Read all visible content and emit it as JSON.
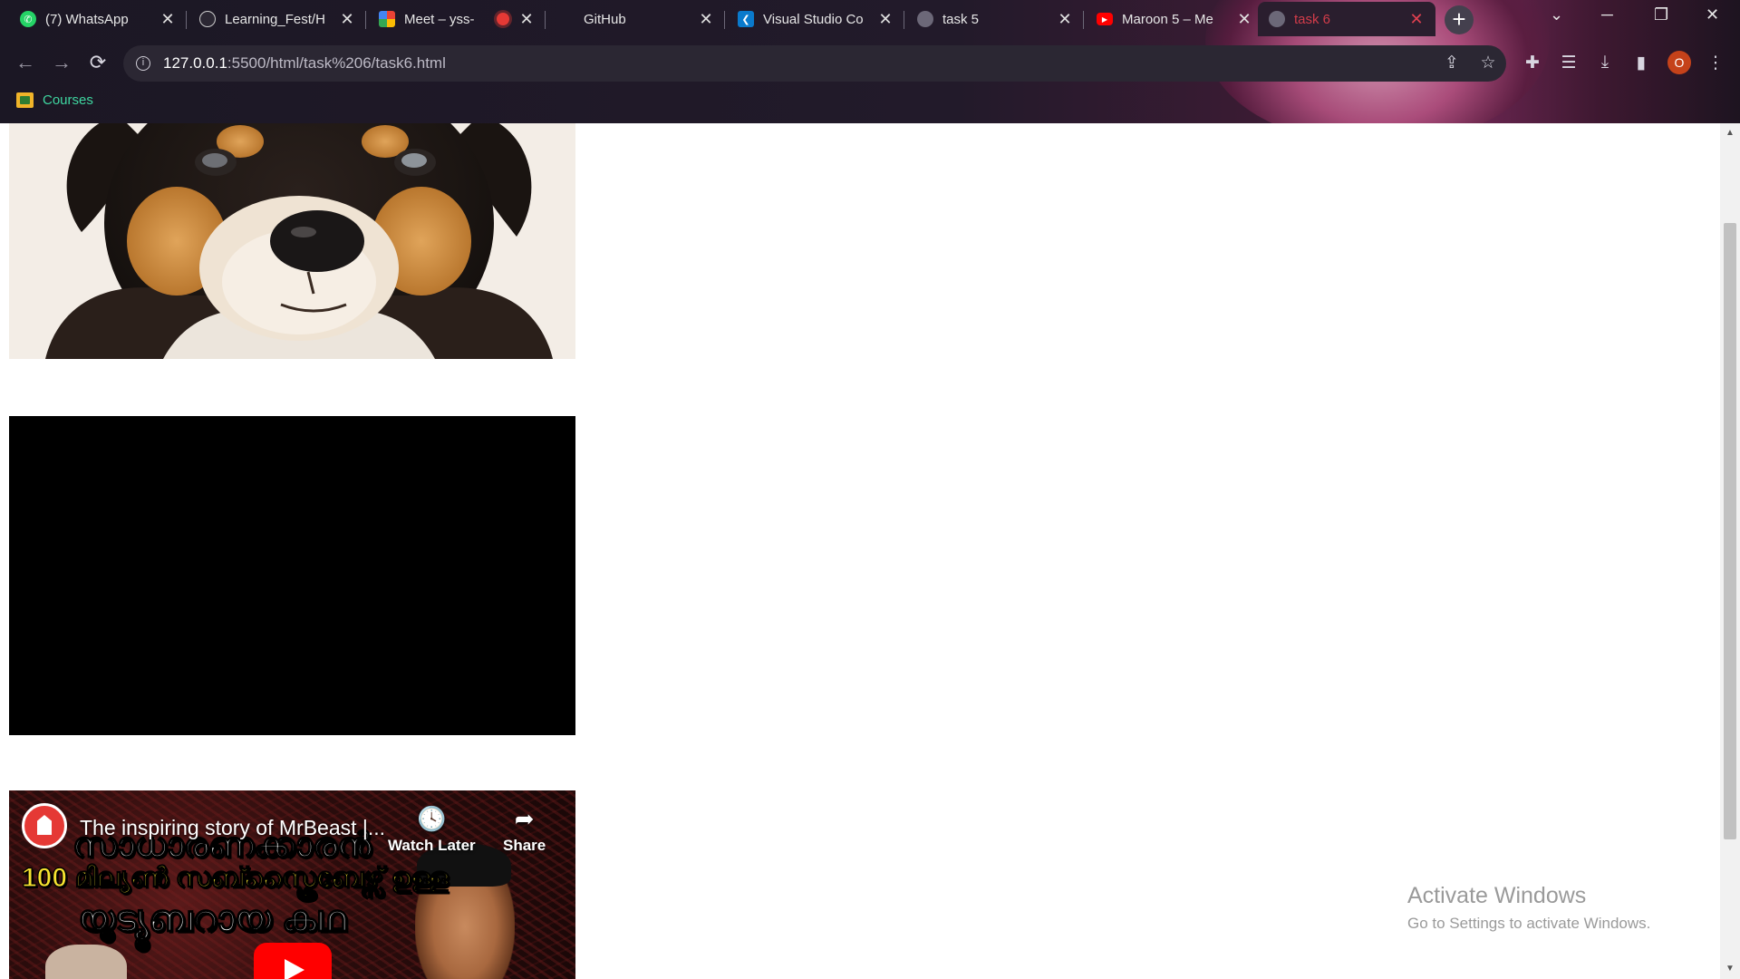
{
  "tabs": [
    {
      "title": "(7) WhatsApp",
      "icon": "whatsapp-icon",
      "color": "#25d366",
      "active": false
    },
    {
      "title": "Learning_Fest/H",
      "icon": "github-icon",
      "color": "#2b2733",
      "active": false
    },
    {
      "title": "Meet – yss-",
      "icon": "google-meet-icon",
      "color": "#00897b",
      "active": false
    },
    {
      "title": "GitHub",
      "icon": "github-icon",
      "color": "#2b2733",
      "active": false
    },
    {
      "title": "Visual Studio Co",
      "icon": "vscode-icon",
      "color": "#0a7acc",
      "active": false
    },
    {
      "title": "task 5",
      "icon": "globe-icon",
      "color": "#6c6878",
      "active": false
    },
    {
      "title": "Maroon 5 – Me",
      "icon": "youtube-icon",
      "color": "#ff0000",
      "active": false
    },
    {
      "title": "task 6",
      "icon": "globe-icon",
      "color": "#6c6878",
      "active": true
    }
  ],
  "tab_close_glyph": "✕",
  "new_tab_glyph": "+",
  "window_controls": {
    "dropdown": "⌄",
    "minimize": "─",
    "restore": "❐",
    "close": "✕"
  },
  "toolbar": {
    "back": "←",
    "forward": "→",
    "reload": "⟳",
    "url_host": "127.0.0.1",
    "url_path": ":5500/html/task%206/task6.html",
    "share": "⇪",
    "bookmark_star": "☆",
    "extensions": "✚",
    "reading_list": "☰",
    "download": "⤓",
    "side_panel": "▮",
    "profile_initial": "O",
    "menu": "⋮"
  },
  "bookmarks": [
    {
      "label": "Courses",
      "icon": "google-classroom-icon"
    }
  ],
  "youtube_embed": {
    "title": "The inspiring story of MrBeast |...",
    "watch_later": "Watch Later",
    "share": "Share",
    "line1": "സാധാരണക്കാരൻ",
    "line2": "100 മില്യൺ സബ്സ്ക്രൈബേഴ്സ് ഉള്ള",
    "line3": "യൂട്യൂബറായ കഥ",
    "colors": {
      "play": "#ff0000",
      "line2": "#f7e330"
    }
  },
  "watermark": {
    "line1": "Activate Windows",
    "line2": "Go to Settings to activate Windows."
  }
}
